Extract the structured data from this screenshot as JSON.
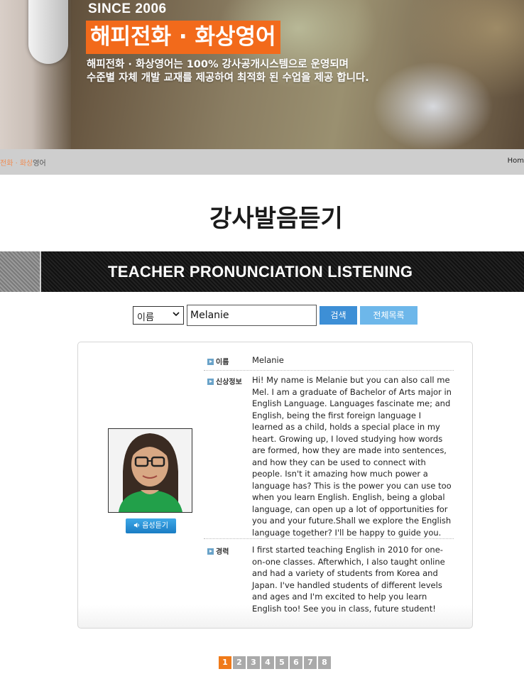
{
  "hero": {
    "since": "SINCE 2006",
    "title": "해피전화 · 화상영어",
    "desc_line1": "해피전화 · 화상영어는 100% 강사공개시스템으로 운영되며",
    "desc_line2": "수준별 자체 개발 교재를 제공하여 최적화 된 수업을 제공 합니다."
  },
  "nav": {
    "brand_part1": "전화 · 화상",
    "brand_part2": "영어",
    "home": "Hom"
  },
  "page_title": "강사발음듣기",
  "banner_text": "TEACHER PRONUNCIATION LISTENING",
  "search": {
    "field_select": "이름",
    "query": "Melanie",
    "search_button": "검색",
    "all_list_button": "전체목록"
  },
  "teacher": {
    "voice_button": "음성듣기",
    "name_label": "이름",
    "name": "Melanie",
    "profile_label": "신상정보",
    "profile": "Hi! My name is Melanie but you can also call me Mel. I am a graduate of Bachelor of Arts major in English Language. Languages fascinate me; and English, being the first foreign language I learned as a child, holds a special place in my heart. Growing up, I loved studying how words are formed, how they are made into sentences, and how they can be used to connect with people. Isn't it amazing how much power a language has? This is the power you can use too when you learn English. English, being a global language, can open up a lot of opportunities for you and your future.Shall we explore the English language together? I'll be happy to guide you.",
    "career_label": "경력",
    "career": "I first started teaching English in 2010 for one-on-one classes. Afterwhich, I also taught online and had a variety of students from Korea and Japan. I've handled students of different levels and ages and I'm excited to help you learn English too! See you in class, future student!"
  },
  "pagination": {
    "pages": [
      "1",
      "2",
      "3",
      "4",
      "5",
      "6",
      "7",
      "8"
    ],
    "active_page": "1"
  }
}
